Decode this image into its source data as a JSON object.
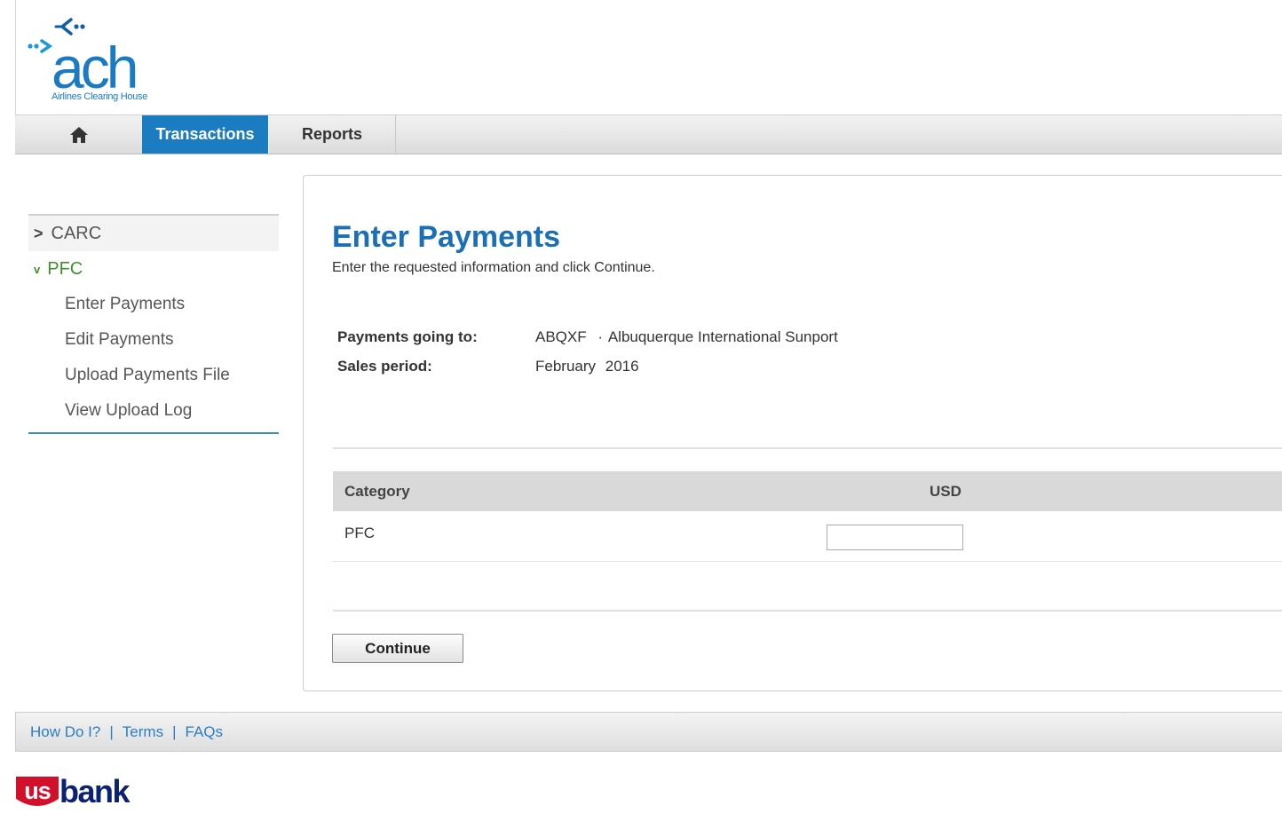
{
  "brand": {
    "logo_text": "ach",
    "logo_tagline": "Airlines Clearing House",
    "accent_blue": "#1c7cc2",
    "footer_logo_us": "us",
    "footer_logo_bank": "bank"
  },
  "nav": {
    "home_icon": "home-icon",
    "tabs": [
      {
        "label": "Transactions",
        "active": true
      },
      {
        "label": "Reports",
        "active": false
      }
    ]
  },
  "sidebar": {
    "sections": [
      {
        "label": "CARC",
        "chevron": ">",
        "expanded": false
      },
      {
        "label": "PFC",
        "chevron": "v",
        "expanded": true,
        "items": [
          "Enter Payments",
          "Edit Payments",
          "Upload Payments File",
          "View Upload Log"
        ]
      }
    ]
  },
  "main": {
    "title": "Enter Payments",
    "subtitle": "Enter the requested information and click Continue.",
    "info": {
      "payments_label": "Payments going to:",
      "payments_code": "ABQXF",
      "payments_sep": "·",
      "payments_name": "Albuquerque International Sunport",
      "period_label": "Sales period:",
      "period_month": "February",
      "period_year": "2016"
    },
    "table": {
      "headers": [
        "Category",
        "USD"
      ],
      "rows": [
        {
          "category": "PFC",
          "usd": ""
        }
      ]
    },
    "continue_label": "Continue"
  },
  "footer": {
    "links": [
      "How Do I?",
      "Terms",
      "FAQs"
    ],
    "separator": "|"
  }
}
